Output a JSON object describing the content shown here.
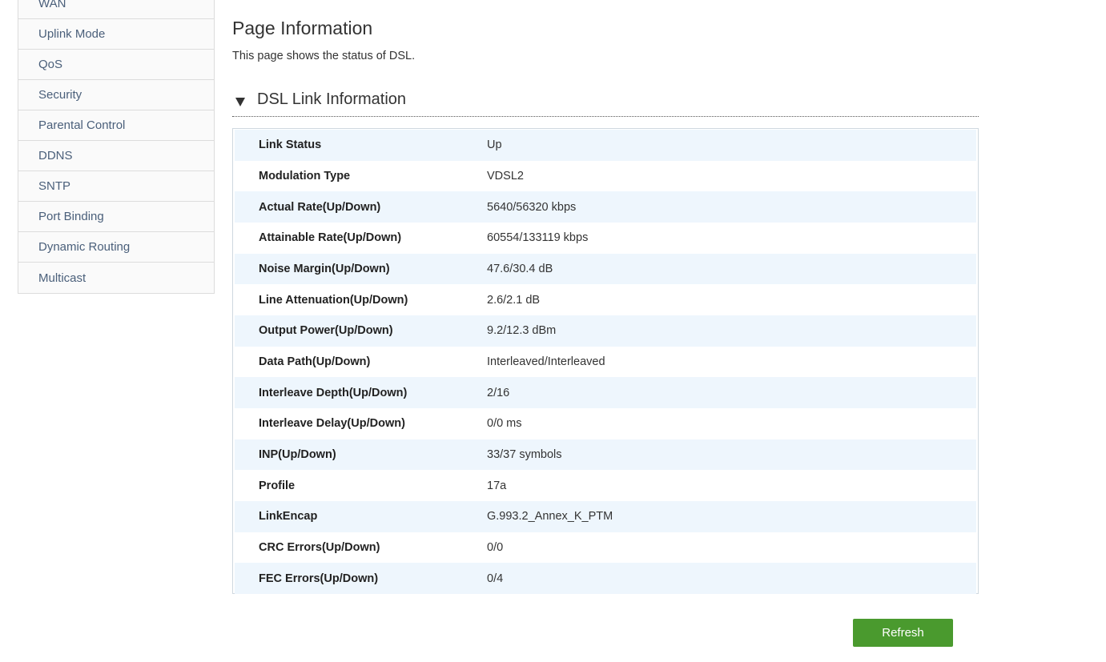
{
  "sidebar": {
    "items": [
      {
        "label": "WAN"
      },
      {
        "label": "Uplink Mode"
      },
      {
        "label": "QoS"
      },
      {
        "label": "Security"
      },
      {
        "label": "Parental Control"
      },
      {
        "label": "DDNS"
      },
      {
        "label": "SNTP"
      },
      {
        "label": "Port Binding"
      },
      {
        "label": "Dynamic Routing"
      },
      {
        "label": "Multicast"
      }
    ]
  },
  "main": {
    "title": "Page Information",
    "description": "This page shows the status of DSL.",
    "section": {
      "title": "DSL Link Information",
      "toggle_icon": "triangle-down-icon",
      "rows": [
        {
          "label": "Link Status",
          "value": "Up"
        },
        {
          "label": "Modulation Type",
          "value": "VDSL2"
        },
        {
          "label": "Actual Rate(Up/Down)",
          "value": "5640/56320 kbps"
        },
        {
          "label": "Attainable Rate(Up/Down)",
          "value": "60554/133119 kbps"
        },
        {
          "label": "Noise Margin(Up/Down)",
          "value": "47.6/30.4 dB"
        },
        {
          "label": "Line Attenuation(Up/Down)",
          "value": "2.6/2.1 dB"
        },
        {
          "label": "Output Power(Up/Down)",
          "value": "9.2/12.3 dBm"
        },
        {
          "label": "Data Path(Up/Down)",
          "value": "Interleaved/Interleaved"
        },
        {
          "label": "Interleave Depth(Up/Down)",
          "value": "2/16"
        },
        {
          "label": "Interleave Delay(Up/Down)",
          "value": "0/0 ms"
        },
        {
          "label": "INP(Up/Down)",
          "value": "33/37 symbols"
        },
        {
          "label": "Profile",
          "value": "17a"
        },
        {
          "label": "LinkEncap",
          "value": "G.993.2_Annex_K_PTM"
        },
        {
          "label": "CRC Errors(Up/Down)",
          "value": "0/0"
        },
        {
          "label": "FEC Errors(Up/Down)",
          "value": "0/4"
        }
      ]
    },
    "refresh_label": "Refresh"
  },
  "colors": {
    "accent_button": "#4a9a2e",
    "sidebar_text": "#4a5f7a",
    "row_alt": "#eef6fd"
  }
}
